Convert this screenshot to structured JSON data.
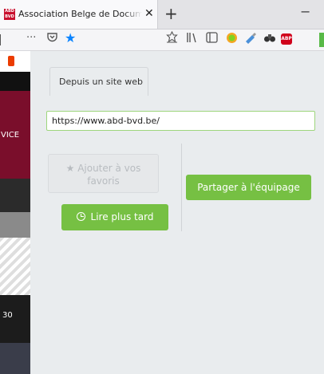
{
  "browser": {
    "tab_title": "Association Belge de Documentation",
    "tab_close": "✕",
    "new_tab": "+",
    "minimize": "−",
    "favicon_text": "ABD BVD",
    "toolbar": {
      "overflow_icon": "···",
      "pocket_icon": "pocket-icon",
      "bookmark_icon": "star-icon",
      "adblock_label": "ABP"
    }
  },
  "background_page": {
    "strip_text_1": "VICE",
    "strip_text_2": "30"
  },
  "popup": {
    "tab_label": "Depuis un site web",
    "url_value": "https://www.abd-bvd.be/",
    "favorites_button": "Ajouter à vos favoris",
    "read_later_button": "Lire plus tard",
    "share_button": "Partager à l'équipage"
  },
  "colors": {
    "accent_green": "#76c043",
    "tab_favicon_red": "#c8102e"
  }
}
